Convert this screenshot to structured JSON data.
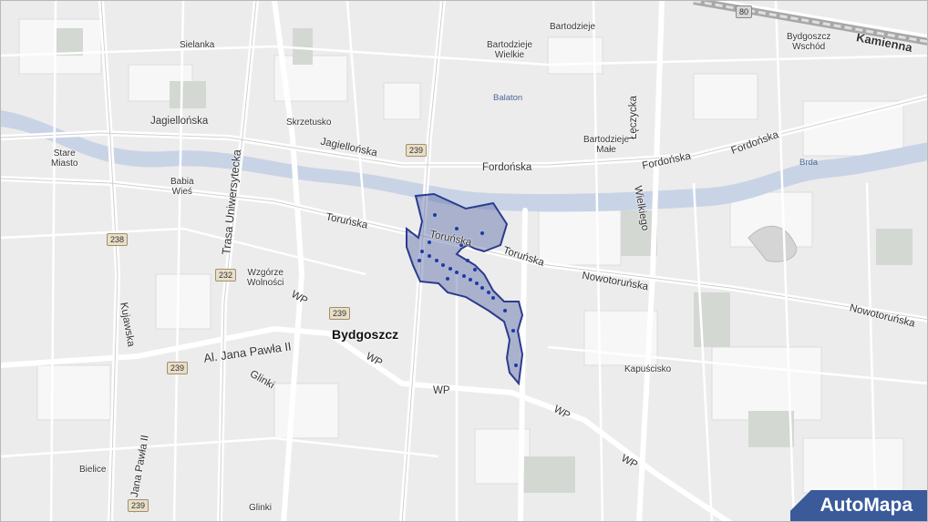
{
  "map": {
    "districts": {
      "sielanka": "Sielanka",
      "bartodzieje": "Bartodzieje",
      "bartodzieje_wielkie": "Bartodzieje\nWielkie",
      "bydgoszcz_wschod": "Bydgoszcz\nWschód",
      "skrzetusko": "Skrzetusko",
      "stare_miasto": "Stare\nMiasto",
      "bartodzieje_male": "Bartodzieje\nMałe",
      "babia_wies": "Babia\nWieś",
      "wzgorze_wolnosci": "Wzgórze\nWolności",
      "kapuscisko": "Kapuścisko",
      "bielice": "Bielice",
      "glinki_bottom": "Glinki"
    },
    "city": "Bydgoszcz",
    "water": {
      "balaton": "Balaton",
      "brda": "Brda"
    },
    "streets": {
      "kamienna": "Kamienna",
      "jagiellonska_1": "Jagiellońska",
      "jagiellonska_2": "Jagiellońska",
      "fordonska_1": "Fordońska",
      "fordonska_2": "Fordońska",
      "fordonska_3": "Fordońska",
      "leczycka": "Łęczycka",
      "wielkiego": "Wielkiego",
      "torunska_1": "Toruńska",
      "torunska_2": "Toruńska",
      "torunska_3": "Toruńska",
      "nowotorunska_1": "Nowotoruńska",
      "nowotorunska_2": "Nowotoruńska",
      "trasa_uniwersytecka": "Trasa Uniwersytecka",
      "kujawska": "Kujawska",
      "al_jana_pawla_ii": "Al. Jana Pawła II",
      "al_jana_pawla_ii_v": "Al. Jana Pawła II",
      "glinki": "Glinki",
      "wp_1": "WP",
      "wp_2": "WP",
      "wp_3": "WP",
      "wp_4": "WP",
      "wp_5": "WP"
    },
    "road_numbers": [
      "80",
      "239",
      "238",
      "232",
      "239",
      "239",
      "239"
    ],
    "logo": "AutoMapa",
    "colors": {
      "area_fill": "#5b6aa8",
      "area_stroke": "#2b3b8f",
      "river": "#c8d4e6",
      "background": "#ececec"
    }
  }
}
